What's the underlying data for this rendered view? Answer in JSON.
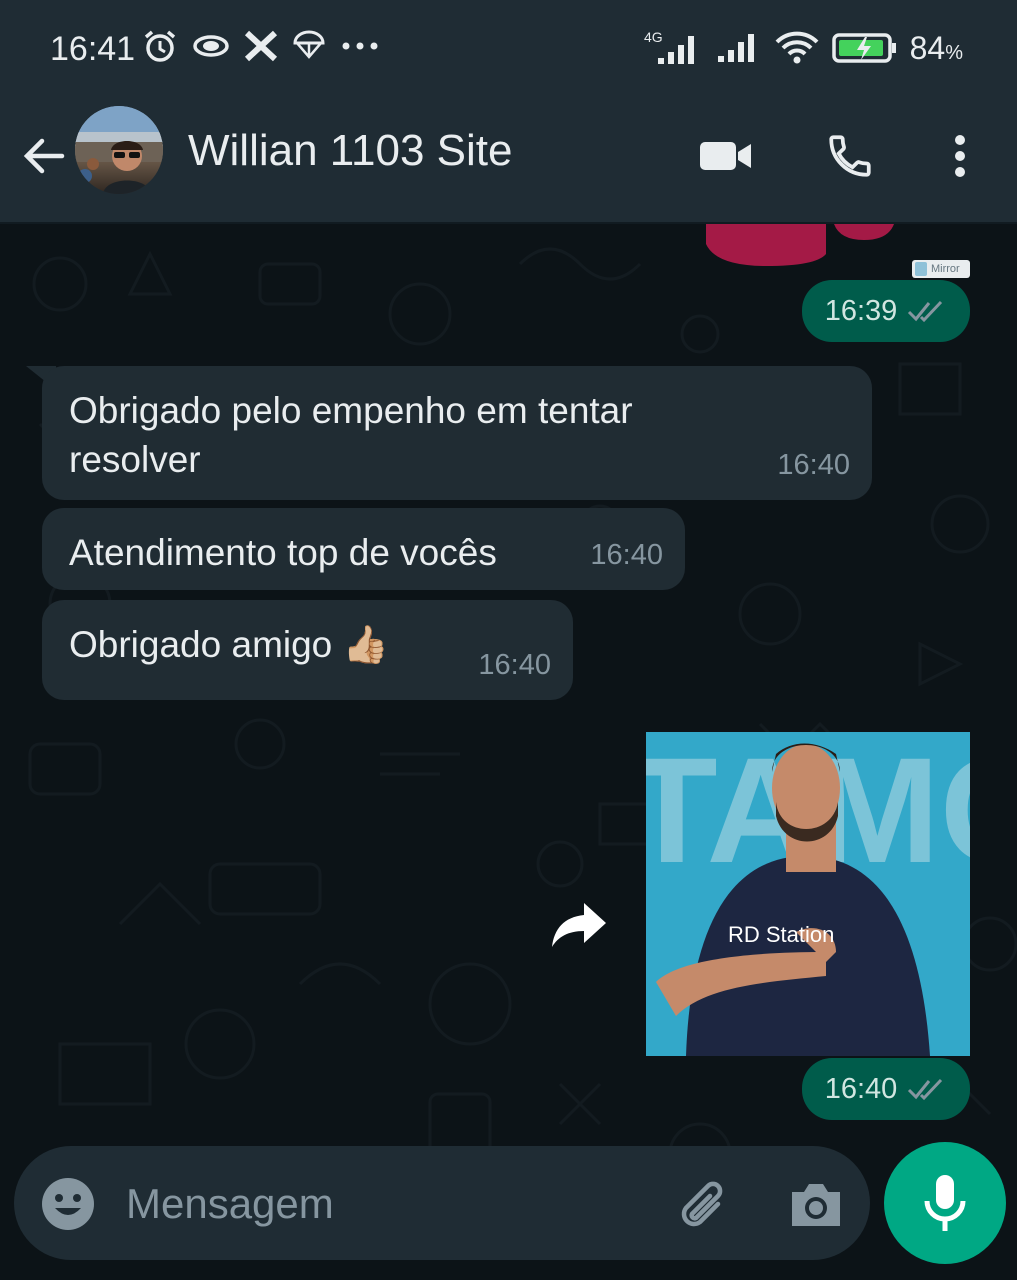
{
  "status_bar": {
    "time": "16:41",
    "network_label": "4G",
    "battery_percent": "84",
    "battery_unit": "%",
    "icons": [
      "alarm-icon",
      "eye-icon",
      "x-app-icon",
      "parachute-icon",
      "more-dots-icon",
      "signal-icon",
      "signal-icon-2",
      "wifi-icon",
      "battery-charging-icon"
    ]
  },
  "header": {
    "contact_name": "Willian 1103 Site",
    "icons": [
      "back-arrow-icon",
      "avatar",
      "video-call-icon",
      "phone-icon",
      "more-vert-icon"
    ]
  },
  "chat": {
    "mirror_tag": "Mirror",
    "messages": [
      {
        "direction": "out",
        "type": "image-tail",
        "time": "16:39",
        "status": "read"
      },
      {
        "direction": "in",
        "text_line1": "Obrigado pelo empenho em tentar",
        "text_line2": "resolver",
        "time": "16:40"
      },
      {
        "direction": "in",
        "text": "Atendimento top de vocês",
        "time": "16:40"
      },
      {
        "direction": "in",
        "text": "Obrigado amigo",
        "emoji": "👍🏼",
        "time": "16:40"
      },
      {
        "direction": "out",
        "type": "image",
        "shirt_text": "RD Station",
        "bg_text": "TAMC",
        "time": "16:40",
        "status": "read"
      }
    ]
  },
  "composer": {
    "placeholder": "Mensagem"
  },
  "colors": {
    "header_bg": "#1f2c34",
    "chat_bg": "#0c1317",
    "incoming_bubble": "#202c33",
    "outgoing_bubble": "#005c4b",
    "accent": "#00a884",
    "read_ticks": "#8696a0"
  }
}
